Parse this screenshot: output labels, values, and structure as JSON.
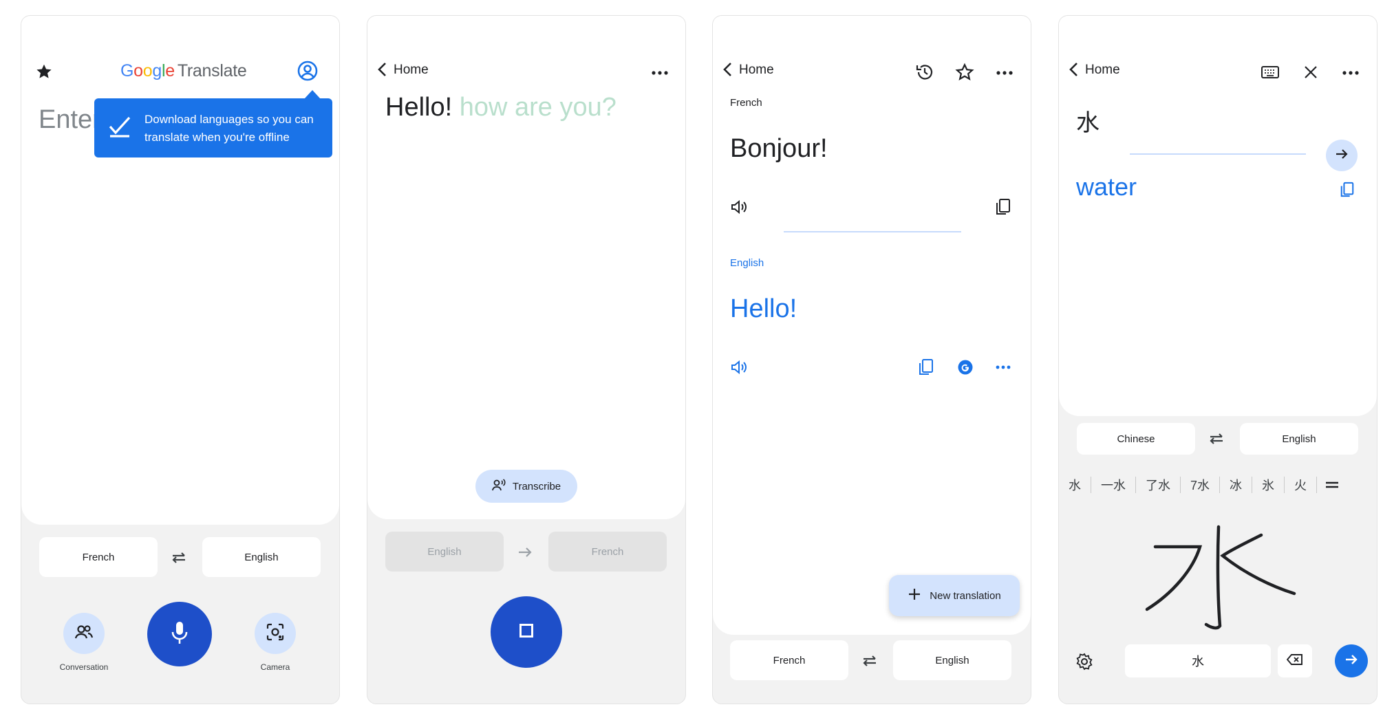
{
  "screen1": {
    "logo": {
      "google": [
        "G",
        "o",
        "o",
        "g",
        "l",
        "e"
      ],
      "translate": "Translate"
    },
    "input_placeholder": "Enter",
    "tooltip": "Download languages so you can translate when you're offline",
    "source_lang": "French",
    "target_lang": "English",
    "conversation_label": "Conversation",
    "camera_label": "Camera"
  },
  "screen2": {
    "back_label": "Home",
    "recognized": "Hello!",
    "partial": "how are you?",
    "transcribe_label": "Transcribe",
    "source_lang": "English",
    "target_lang": "French"
  },
  "screen3": {
    "back_label": "Home",
    "source_lang_label": "French",
    "source_text": "Bonjour!",
    "target_lang_label": "English",
    "target_text": "Hello!",
    "new_translation_label": "New translation",
    "source_lang": "French",
    "target_lang": "English"
  },
  "screen4": {
    "back_label": "Home",
    "input_char": "水",
    "translation": "water",
    "source_lang": "Chinese",
    "target_lang": "English",
    "candidates": [
      "水",
      "一水",
      "了水",
      "7水",
      "冰",
      "氷",
      "火"
    ],
    "handwriting_char": "水",
    "input_value": "水"
  },
  "colors": {
    "accent": "#1a73e8",
    "primary_button": "#1e4fc9",
    "chip_bg": "#d3e3fd",
    "screen_bg": "#f2f2f2"
  }
}
